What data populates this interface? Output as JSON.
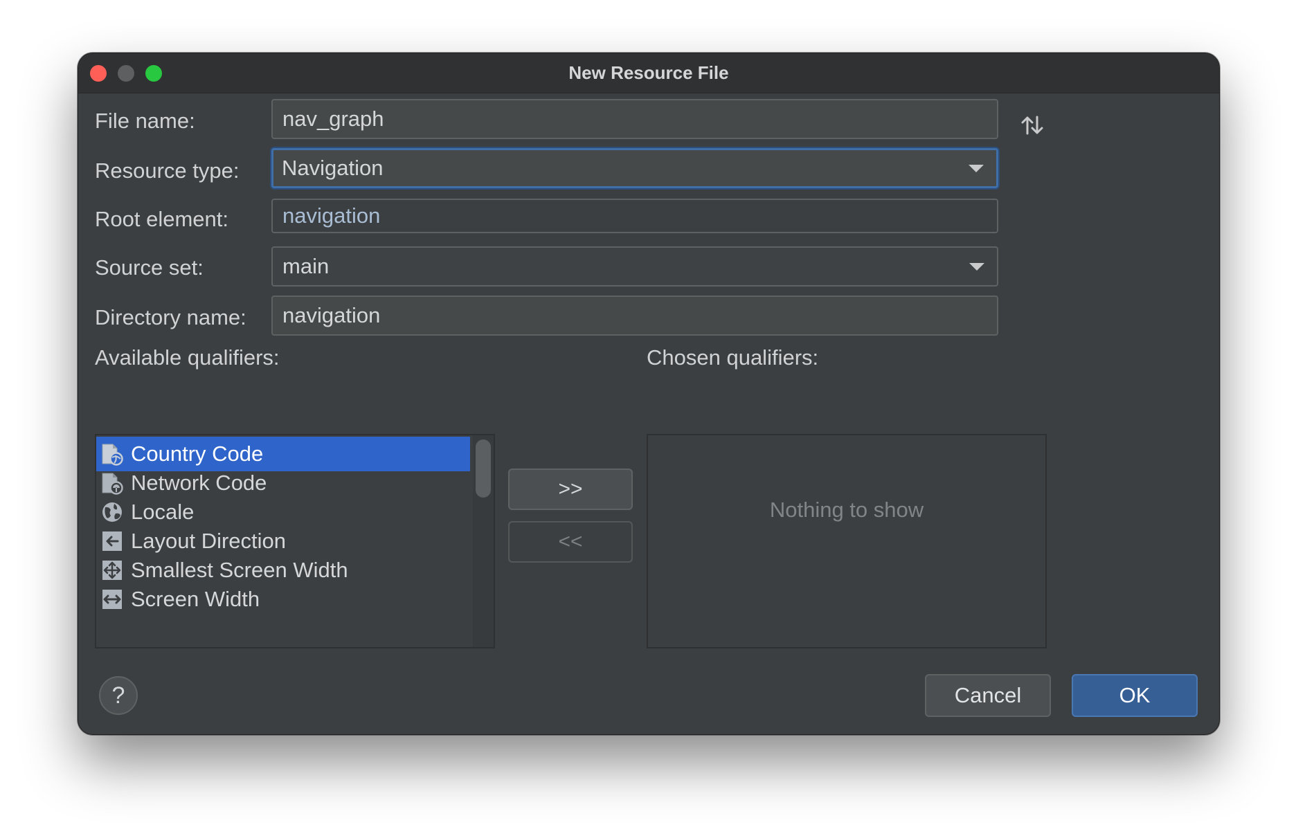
{
  "window": {
    "title": "New Resource File"
  },
  "form": {
    "file_name": {
      "label": "File name:",
      "value": "nav_graph"
    },
    "resource_type": {
      "label": "Resource type:",
      "value": "Navigation"
    },
    "root_element": {
      "label": "Root element:",
      "value": "navigation"
    },
    "source_set": {
      "label": "Source set:",
      "value": "main"
    },
    "directory_name": {
      "label": "Directory name:",
      "value": "navigation"
    }
  },
  "qualifiers": {
    "available_label": "Available qualifiers:",
    "chosen_label": "Chosen qualifiers:",
    "available": [
      {
        "label": "Country Code",
        "icon": "country-code-icon",
        "selected": true
      },
      {
        "label": "Network Code",
        "icon": "network-code-icon",
        "selected": false
      },
      {
        "label": "Locale",
        "icon": "globe-icon",
        "selected": false
      },
      {
        "label": "Layout Direction",
        "icon": "layout-direction-icon",
        "selected": false
      },
      {
        "label": "Smallest Screen Width",
        "icon": "smallest-screen-width-icon",
        "selected": false
      },
      {
        "label": "Screen Width",
        "icon": "screen-width-icon",
        "selected": false
      }
    ],
    "add_button": ">>",
    "remove_button": "<<",
    "empty_text": "Nothing to show"
  },
  "footer": {
    "help": "?",
    "cancel": "Cancel",
    "ok": "OK"
  },
  "colors": {
    "background": "#3c3f41",
    "selection": "#2f65ca",
    "primary_button": "#365f96",
    "focus_ring": "#3f6ea8"
  }
}
